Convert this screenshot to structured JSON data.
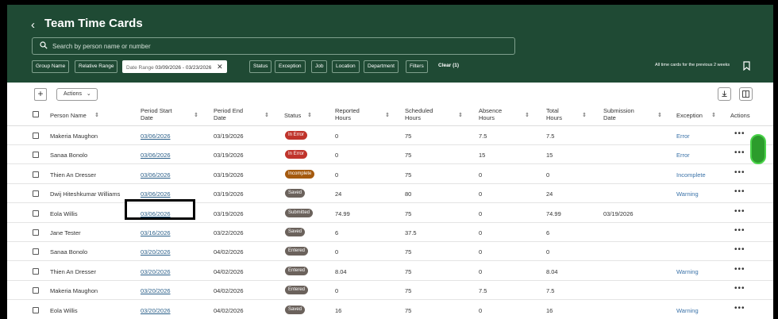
{
  "header": {
    "title": "Team Time Cards",
    "search_placeholder": "Search by person name or number",
    "chips": {
      "group_name": "Group Name",
      "relative_range": "Relative Range",
      "date_range_label": "Date Range",
      "date_range_value": "03/09/2026 - 03/23/2026",
      "status": "Status",
      "exception": "Exception",
      "job": "Job",
      "location": "Location",
      "department": "Department",
      "filters": "Filters",
      "clear": "Clear (1)"
    },
    "note": "All time cards for the previous 2 weeks"
  },
  "toolbar": {
    "plus": "+",
    "actions_label": "Actions"
  },
  "columns": {
    "person": "Person Name",
    "period_start_1": "Period Start",
    "period_start_2": "Date",
    "period_end_1": "Period End",
    "period_end_2": "Date",
    "status": "Status",
    "reported_1": "Reported",
    "reported_2": "Hours",
    "scheduled_1": "Scheduled",
    "scheduled_2": "Hours",
    "absence_1": "Absence",
    "absence_2": "Hours",
    "total_1": "Total",
    "total_2": "Hours",
    "submission_1": "Submission",
    "submission_2": "Date",
    "exception": "Exception",
    "actions": "Actions"
  },
  "rows": [
    {
      "person": "Makeria Maughon",
      "start": "03/06/2026",
      "end": "03/19/2026",
      "status": "In Error",
      "reported": "0",
      "scheduled": "75",
      "absence": "7.5",
      "total": "7.5",
      "submission": "",
      "exception": "Error",
      "more": "•••"
    },
    {
      "person": "Sanaa Bonolo",
      "start": "03/06/2026",
      "end": "03/19/2026",
      "status": "In Error",
      "reported": "0",
      "scheduled": "75",
      "absence": "15",
      "total": "15",
      "submission": "",
      "exception": "Error",
      "more": "•••"
    },
    {
      "person": "Thien An Dresser",
      "start": "03/06/2026",
      "end": "03/19/2026",
      "status": "Incomplete",
      "reported": "0",
      "scheduled": "75",
      "absence": "0",
      "total": "0",
      "submission": "",
      "exception": "Incomplete",
      "more": "•••"
    },
    {
      "person": "Dwij Hiteshkumar Williams",
      "start": "03/06/2026",
      "end": "03/19/2026",
      "status": "Saved",
      "reported": "24",
      "scheduled": "80",
      "absence": "0",
      "total": "24",
      "submission": "",
      "exception": "Warning",
      "more": "•••"
    },
    {
      "person": "Eola Willis",
      "start": "03/06/2026",
      "end": "03/19/2026",
      "status": "Submitted",
      "reported": "74.99",
      "scheduled": "75",
      "absence": "0",
      "total": "74.99",
      "submission": "03/19/2026",
      "exception": "",
      "more": "•••"
    },
    {
      "person": "Jane Tester",
      "start": "03/16/2026",
      "end": "03/22/2026",
      "status": "Saved",
      "reported": "6",
      "scheduled": "37.5",
      "absence": "0",
      "total": "6",
      "submission": "",
      "exception": "",
      "more": "•••"
    },
    {
      "person": "Sanaa Bonolo",
      "start": "03/20/2026",
      "end": "04/02/2026",
      "status": "Entered",
      "reported": "0",
      "scheduled": "75",
      "absence": "0",
      "total": "0",
      "submission": "",
      "exception": "",
      "more": "•••"
    },
    {
      "person": "Thien An Dresser",
      "start": "03/20/2026",
      "end": "04/02/2026",
      "status": "Entered",
      "reported": "8.04",
      "scheduled": "75",
      "absence": "0",
      "total": "8.04",
      "submission": "",
      "exception": "Warning",
      "more": "•••"
    },
    {
      "person": "Makeria Maughon",
      "start": "03/20/2026",
      "end": "04/02/2026",
      "status": "Entered",
      "reported": "0",
      "scheduled": "75",
      "absence": "7.5",
      "total": "7.5",
      "submission": "",
      "exception": "",
      "more": "•••"
    },
    {
      "person": "Eola Willis",
      "start": "03/20/2026",
      "end": "04/02/2026",
      "status": "Saved",
      "reported": "16",
      "scheduled": "75",
      "absence": "0",
      "total": "16",
      "submission": "",
      "exception": "Warning",
      "more": "•••"
    }
  ],
  "status_colors": {
    "In Error": "#c0342c",
    "Incomplete": "#a55a0e",
    "Saved": "#6b625c",
    "Submitted": "#6b625c",
    "Entered": "#6b625c"
  },
  "colors": {
    "header_bg": "#1f4a34",
    "link": "#2a5f89",
    "fab": "#2c9c2c"
  }
}
